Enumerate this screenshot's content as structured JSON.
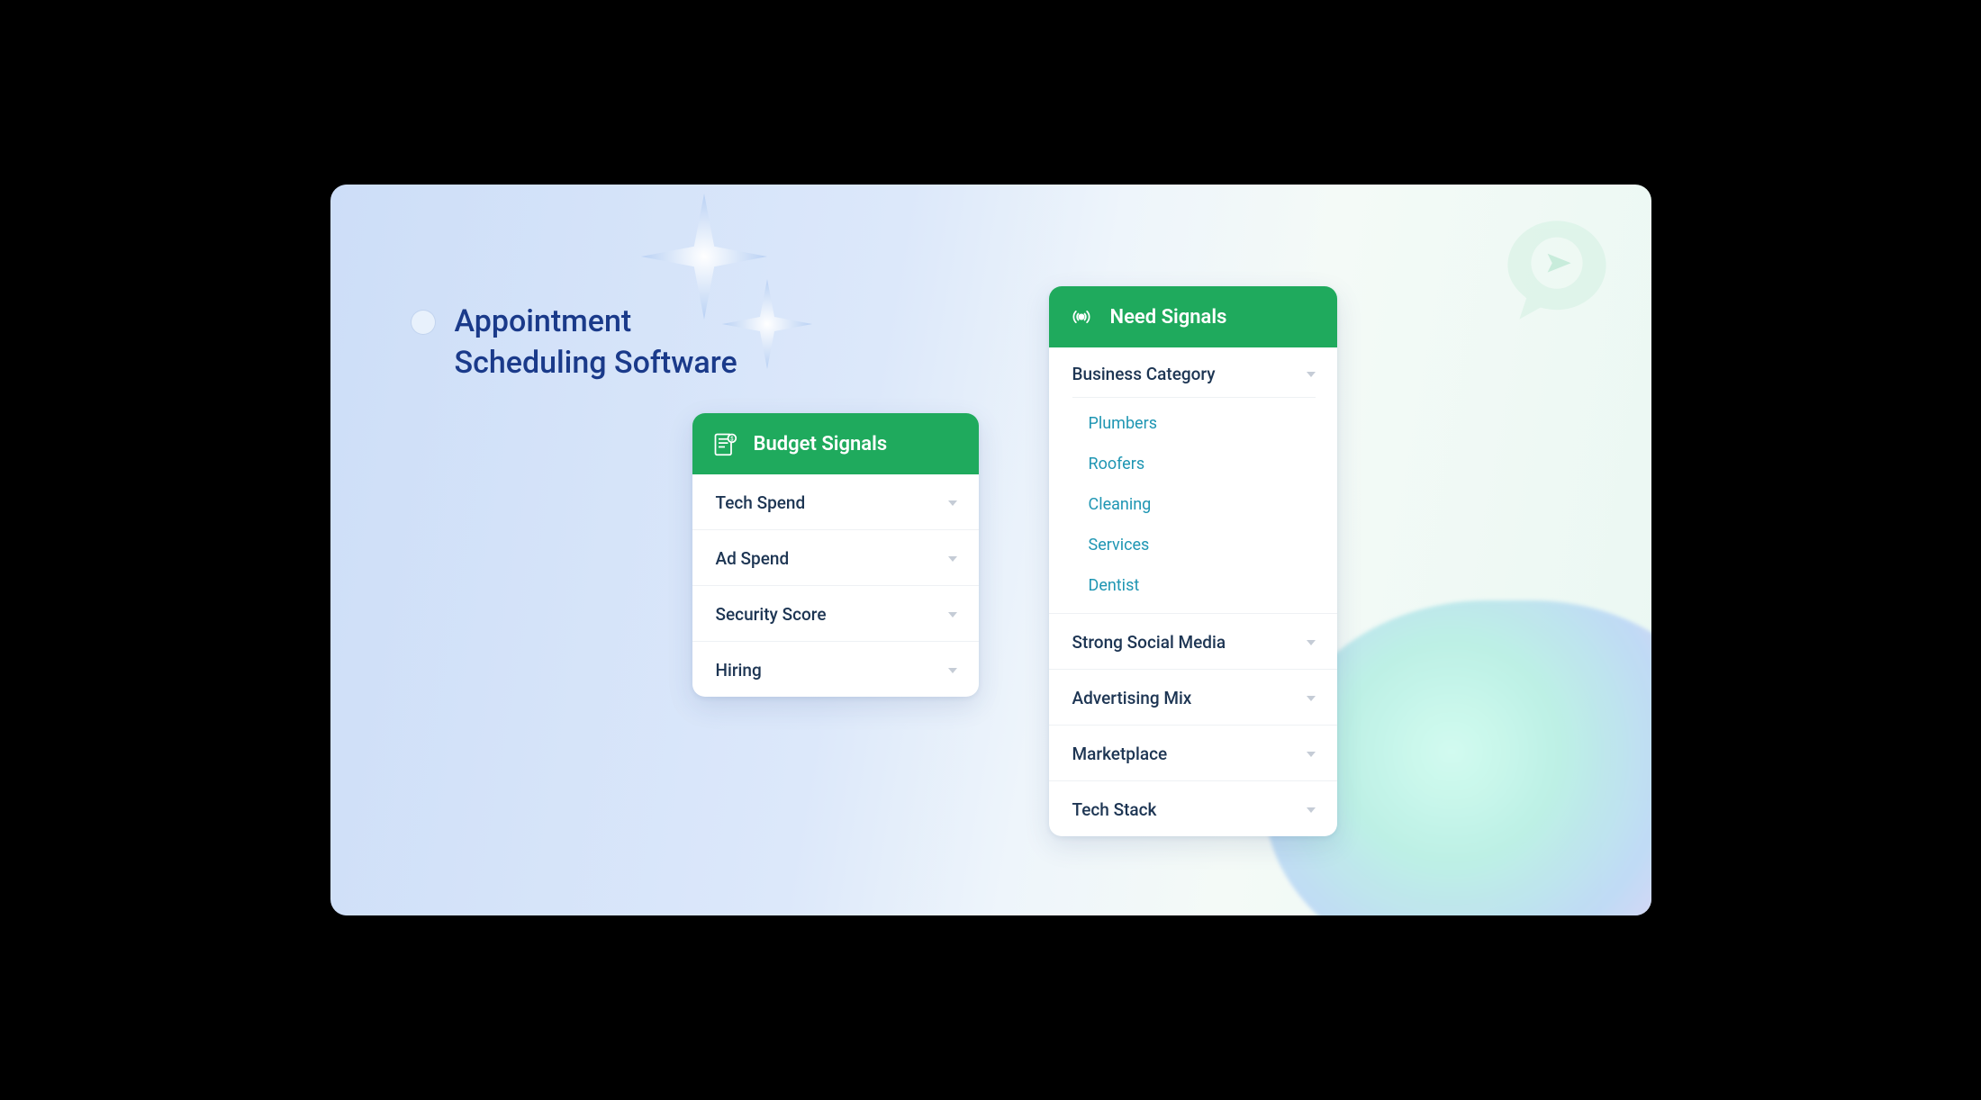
{
  "title": {
    "line1": "Appointment",
    "line2": "Scheduling Software"
  },
  "colors": {
    "brand_green": "#1faa5d",
    "title_blue": "#1a3a8a",
    "link_teal": "#1f96b3",
    "text_dark": "#1d3553"
  },
  "budget_card": {
    "title": "Budget Signals",
    "rows": [
      {
        "label": "Tech Spend"
      },
      {
        "label": "Ad Spend"
      },
      {
        "label": "Security Score"
      },
      {
        "label": "Hiring"
      }
    ]
  },
  "need_card": {
    "title": "Need Signals",
    "section": {
      "label": "Business Category",
      "items": [
        "Plumbers",
        "Roofers",
        "Cleaning",
        "Services",
        "Dentist"
      ]
    },
    "rows": [
      {
        "label": "Strong Social Media"
      },
      {
        "label": "Advertising Mix"
      },
      {
        "label": "Marketplace"
      },
      {
        "label": "Tech Stack"
      }
    ]
  }
}
